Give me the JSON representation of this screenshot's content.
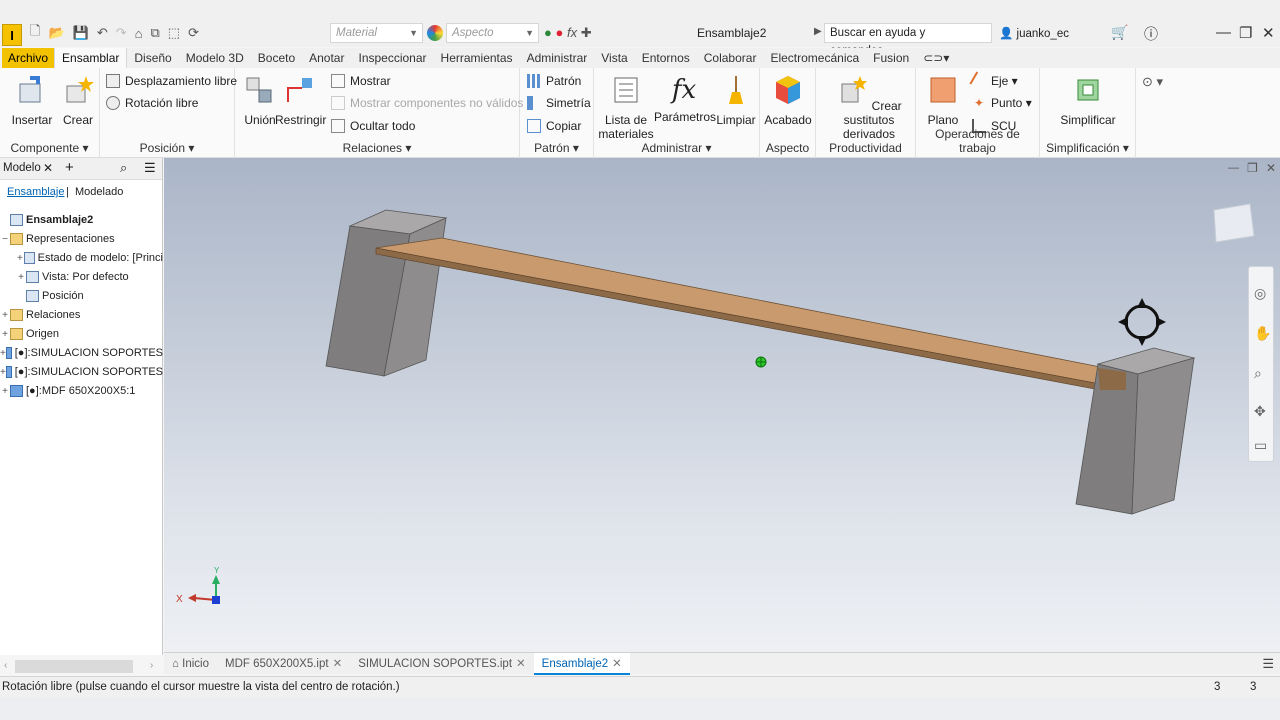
{
  "app": {
    "logo": "I",
    "document_title": "Ensamblaje2",
    "material_placeholder": "Material",
    "aspect_placeholder": "Aspecto",
    "help_search": "Buscar en ayuda y comandos...",
    "user": "juanko_ec"
  },
  "tabs": [
    "Archivo",
    "Ensamblar",
    "Diseño",
    "Modelo 3D",
    "Boceto",
    "Anotar",
    "Inspeccionar",
    "Herramientas",
    "Administrar",
    "Vista",
    "Entornos",
    "Colaborar",
    "Electromecánica",
    "Fusion"
  ],
  "ribbon": {
    "componente": {
      "title": "Componente",
      "insertar": "Insertar",
      "crear": "Crear"
    },
    "posicion": {
      "title": "Posición",
      "desplazamiento": "Desplazamiento libre",
      "rotacion": "Rotación libre"
    },
    "relaciones": {
      "title": "Relaciones",
      "union": "Unión",
      "restringir": "Restringir",
      "mostrar": "Mostrar",
      "mostrar_no_validos": "Mostrar componentes no válidos",
      "ocultar_todo": "Ocultar todo"
    },
    "patron": {
      "title": "Patrón",
      "patron": "Patrón",
      "simetria": "Simetría",
      "copiar": "Copiar"
    },
    "administrar": {
      "title": "Administrar",
      "lista": "Lista de",
      "lista2": "materiales",
      "parametros": "Parámetros",
      "limpiar": "Limpiar"
    },
    "aspecto": {
      "title": "Aspecto",
      "acabado": "Acabado"
    },
    "productividad": {
      "title": "Productividad",
      "crear_sustitutos": "Crear sustitutos",
      "derivados": "derivados"
    },
    "operaciones": {
      "title": "Operaciones de trabajo",
      "plano": "Plano",
      "eje": "Eje",
      "punto": "Punto",
      "scu": "SCU"
    },
    "simplificacion": {
      "title": "Simplificación",
      "simplificar": "Simplificar"
    }
  },
  "browser": {
    "title": "Modelo",
    "subtab_ensamblaje": "Ensamblaje",
    "subtab_modelado": "Modelado",
    "root": "Ensamblaje2",
    "items": [
      {
        "label": "Representaciones"
      },
      {
        "label": "Estado de modelo: [Princi"
      },
      {
        "label": "Vista: Por defecto"
      },
      {
        "label": "Posición"
      },
      {
        "label": "Relaciones"
      },
      {
        "label": "Origen"
      },
      {
        "label": "[●]:SIMULACION SOPORTES"
      },
      {
        "label": "[●]:SIMULACION SOPORTES"
      },
      {
        "label": "[●]:MDF 650X200X5:1"
      }
    ]
  },
  "viewport": {
    "axis_x": "X",
    "axis_y": "Y"
  },
  "doc_tabs": {
    "inicio": "Inicio",
    "tab1": "MDF 650X200X5.ipt",
    "tab2": "SIMULACION SOPORTES.ipt",
    "tab3": "Ensamblaje2"
  },
  "status": {
    "text": "Rotación libre (pulse cuando el cursor muestre la vista del centro de rotación.)",
    "count1": "3",
    "count2": "3"
  },
  "colors": {
    "accent_file": "#f2c200",
    "active_tab": "#0064b4",
    "board": "#c99a6e",
    "block": "#8a8888"
  }
}
